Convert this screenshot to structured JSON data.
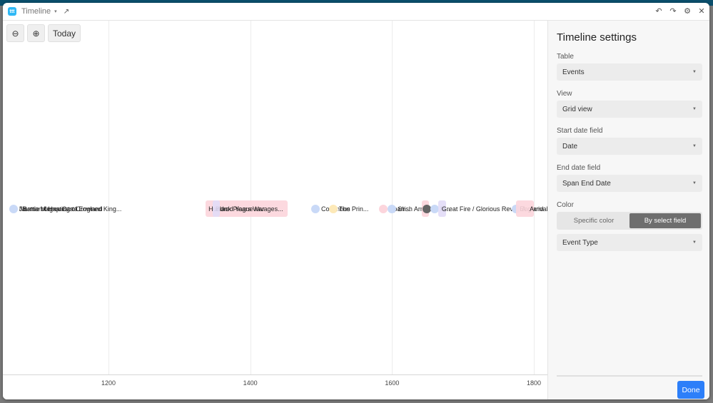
{
  "window": {
    "title": "Timeline",
    "app_icon_glyph": "ttt",
    "title_caret": "▾",
    "popout_icon": "↗",
    "controls": [
      {
        "name": "undo-icon",
        "glyph": "↶"
      },
      {
        "name": "redo-icon",
        "glyph": "↷"
      },
      {
        "name": "gear-icon",
        "glyph": "⚙"
      },
      {
        "name": "close-icon",
        "glyph": "✕"
      }
    ]
  },
  "toolbar": {
    "zoom_out_glyph": "⊖",
    "zoom_in_glyph": "⊕",
    "today_label": "Today"
  },
  "timeline": {
    "axis_ticks": [
      "1200",
      "1400",
      "1600",
      "1800"
    ],
    "events": [
      {
        "label": "Norman conquest of England",
        "type": "dot",
        "color": "#c9d9f7",
        "year": 1066
      },
      {
        "label": "Jo...",
        "type": "label",
        "year": 1070
      },
      {
        "label": "Battle of Hastings",
        "type": "label",
        "year": 1075
      },
      {
        "label": "Magna Carta",
        "type": "label",
        "year": 1100
      },
      {
        "label": "Crowned King...",
        "type": "label",
        "year": 1150
      },
      {
        "label": "Hundred Years War",
        "type": "span",
        "color": "#fcd5dc",
        "year": 1337,
        "end_year": 1453
      },
      {
        "label": "Black Plague ravages...",
        "type": "label",
        "year": 1347
      },
      {
        "label": "",
        "type": "span",
        "color": "#e2dbf7",
        "year": 1347,
        "end_year": 1352
      },
      {
        "label": "Columbus",
        "type": "dot",
        "color": "#c9d9f7",
        "year": 1492
      },
      {
        "label": "The Prin...",
        "type": "dot",
        "color": "#fde9b8",
        "year": 1517
      },
      {
        "label": "Spanish Armada",
        "type": "dot",
        "color": "#fcd5dc",
        "year": 1588
      },
      {
        "label": "Sh...",
        "type": "dot",
        "color": "#c9d9f7",
        "year": 1600
      },
      {
        "label": "",
        "type": "span",
        "color": "#fcd5dc",
        "year": 1642,
        "end_year": 1651
      },
      {
        "label": "",
        "type": "dot",
        "color": "#666666",
        "year": 1649
      },
      {
        "label": "N...",
        "type": "dot",
        "color": "#c9d9f7",
        "year": 1660
      },
      {
        "label": "",
        "type": "span",
        "color": "#e2dbf7",
        "year": 1665,
        "end_year": 1676
      },
      {
        "label": "Great Fire / Glorious Rev... England",
        "type": "label",
        "year": 1666
      },
      {
        "label": "A...",
        "type": "dot",
        "color": "#c9d9f7",
        "year": 1775
      },
      {
        "label": "",
        "type": "span",
        "color": "#fcd5dc",
        "year": 1775,
        "end_year": 1800
      },
      {
        "label": "Arrival...",
        "type": "label",
        "year": 1790
      }
    ]
  },
  "sidebar": {
    "title": "Timeline settings",
    "table": {
      "label": "Table",
      "value": "Events"
    },
    "view": {
      "label": "View",
      "value": "Grid view"
    },
    "start_date": {
      "label": "Start date field",
      "value": "Date"
    },
    "end_date": {
      "label": "End date field",
      "value": "Span End Date"
    },
    "color": {
      "label": "Color",
      "options": [
        "Specific color",
        "By select field"
      ],
      "selected": "By select field",
      "field_value": "Event Type"
    },
    "caret": "▼",
    "done_label": "Done"
  },
  "colors": {
    "accent": "#2d7ff9",
    "app_icon": "#2eb8f5",
    "top_strip": "#0b4f6c"
  }
}
